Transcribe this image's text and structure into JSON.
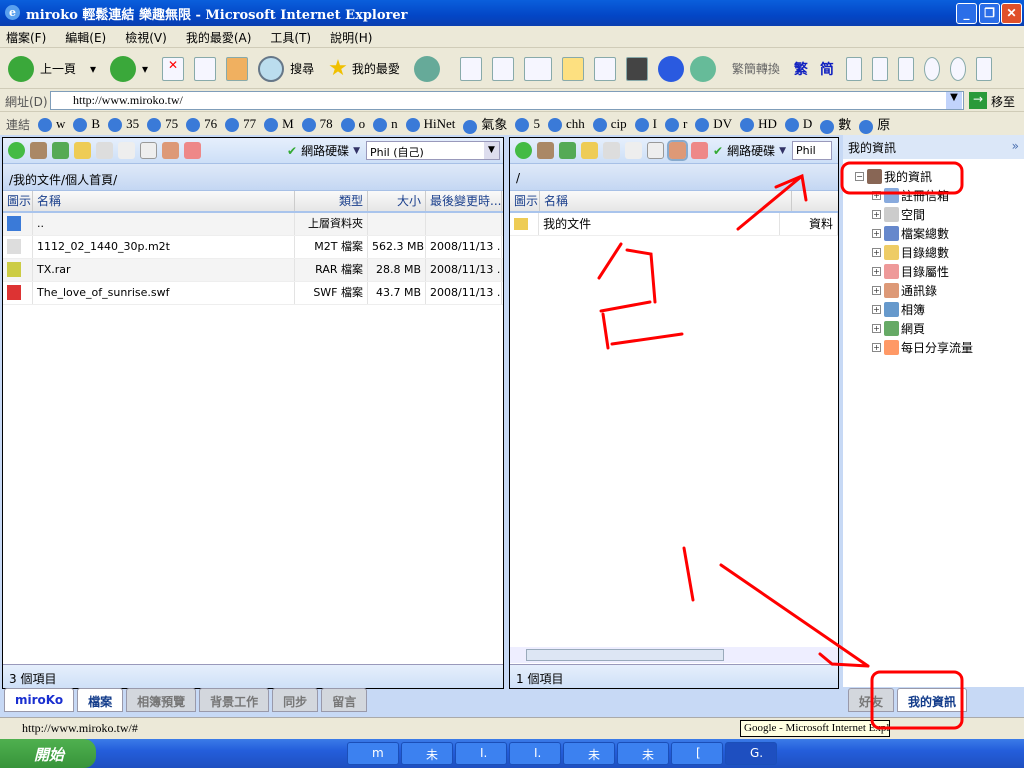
{
  "window": {
    "title": "miroko 輕鬆連結 樂趣無限 - Microsoft Internet Explorer"
  },
  "menu": [
    "檔案(F)",
    "編輯(E)",
    "檢視(V)",
    "我的最愛(A)",
    "工具(T)",
    "說明(H)"
  ],
  "toolbar": {
    "back": "上一頁",
    "search": "搜尋",
    "favorites": "我的最愛",
    "convert": "繁簡轉換",
    "trad": "繁",
    "simp": "简"
  },
  "address": {
    "label": "網址(D)",
    "url": "http://www.miroko.tw/",
    "go": "移至"
  },
  "links": {
    "label": "連結",
    "items": [
      "w",
      "B",
      "35",
      "75",
      "76",
      "77",
      "M",
      "78",
      "o",
      "n",
      "HiNet",
      "氣象",
      "5",
      "chh",
      "cip",
      "I",
      "r",
      "DV",
      "HD",
      "D",
      "數",
      "原"
    ]
  },
  "left_panel": {
    "drive": "網路硬碟",
    "user": "Phil (自己)",
    "path": "/我的文件/個人首頁/",
    "columns": [
      "圖示",
      "名稱",
      "類型",
      "大小",
      "最後變更時..."
    ],
    "rows": [
      {
        "name": "..",
        "type": "上層資料夾",
        "size": "",
        "date": ""
      },
      {
        "name": "1112_02_1440_30p.m2t",
        "type": "M2T 檔案",
        "size": "562.3 MB",
        "date": "2008/11/13 ..."
      },
      {
        "name": "TX.rar",
        "type": "RAR 檔案",
        "size": "28.8 MB",
        "date": "2008/11/13 ..."
      },
      {
        "name": "The_love_of_sunrise.swf",
        "type": "SWF 檔案",
        "size": "43.7 MB",
        "date": "2008/11/13 ..."
      }
    ],
    "status": "3 個項目"
  },
  "right_panel": {
    "drive": "網路硬碟",
    "user": "Phil",
    "path": "/",
    "columns": [
      "圖示",
      "名稱"
    ],
    "rows": [
      {
        "name": "我的文件",
        "type": "資料"
      }
    ],
    "status": "1 個項目"
  },
  "tabs": [
    "miroKo",
    "檔案",
    "相簿預覽",
    "背景工作",
    "同步",
    "留言"
  ],
  "sidebar": {
    "title": "我的資訊",
    "root": "我的資訊",
    "items": [
      "註冊信箱",
      "空間",
      "檔案總數",
      "目錄總數",
      "目錄屬性",
      "通訊錄",
      "相簿",
      "網頁",
      "每日分享流量"
    ],
    "tabs": [
      "好友",
      "我的資訊"
    ]
  },
  "statusbar": {
    "url": "http://www.miroko.tw/#",
    "tooltip": "Google - Microsoft Internet Explorer"
  },
  "taskbar": {
    "start": "開始",
    "buttons": [
      "m",
      "未",
      "I.",
      "I.",
      "未",
      "未",
      "[",
      "G."
    ]
  },
  "colors": {
    "titlebar": "#0346c6",
    "annotation": "#ff0000"
  }
}
